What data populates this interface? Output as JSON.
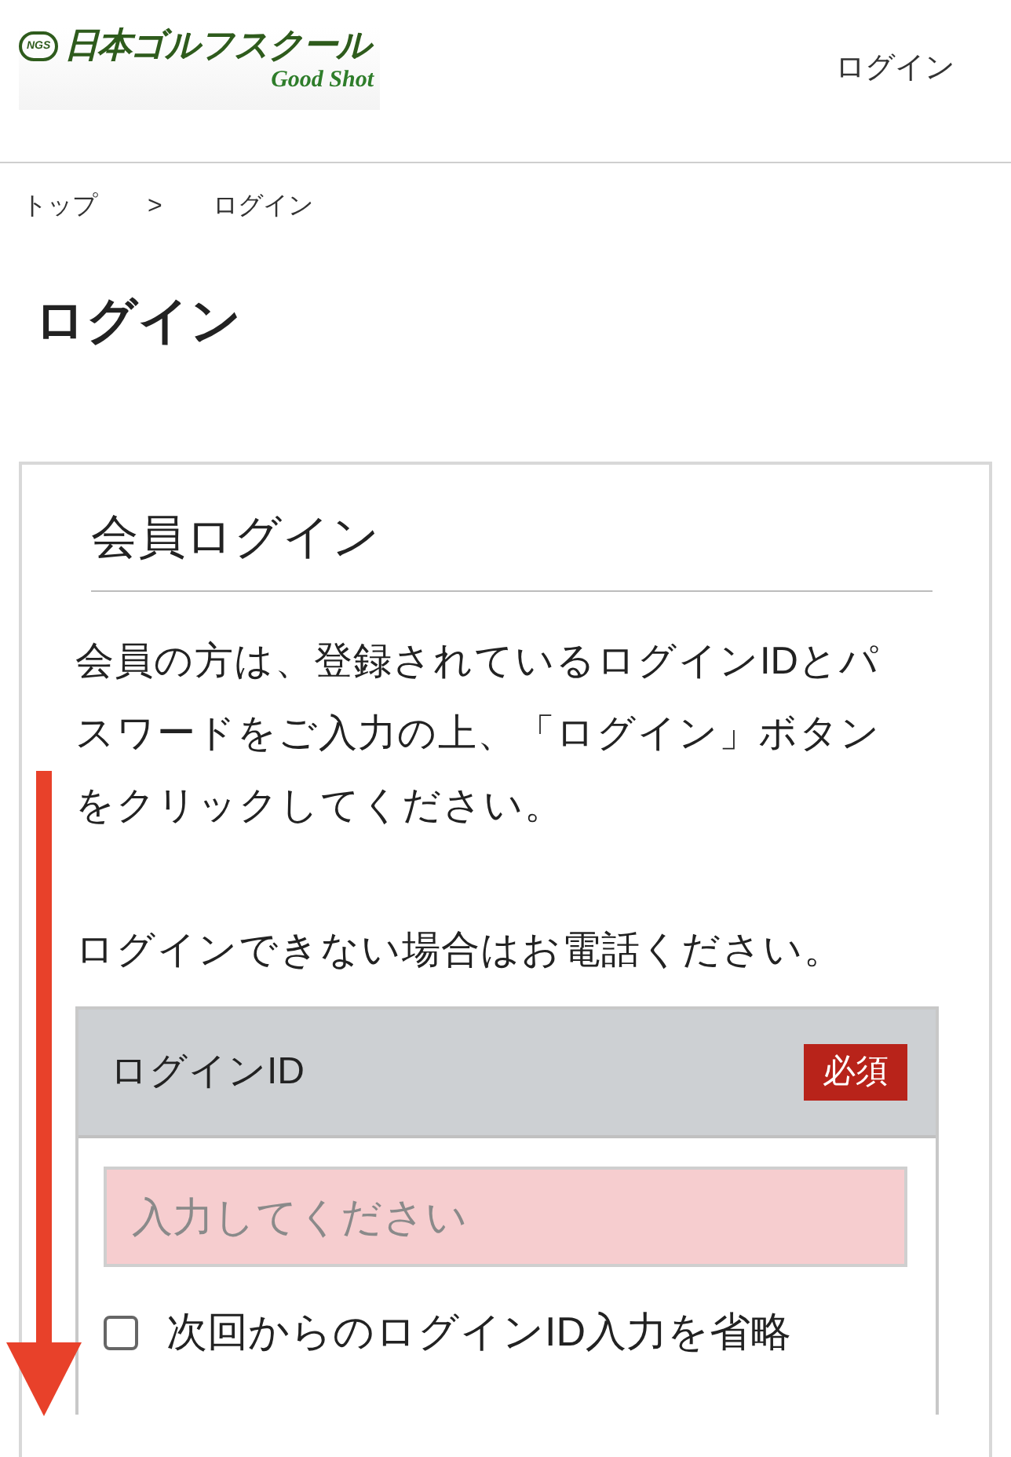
{
  "header": {
    "logo": {
      "mark": "NGS",
      "name": "日本ゴルフスクール",
      "tagline": "Good Shot"
    },
    "nav_link": "ログイン"
  },
  "breadcrumb": [
    {
      "label": "トップ"
    },
    {
      "label": ">"
    },
    {
      "label": "ログイン"
    }
  ],
  "page_title": "ログイン",
  "card": {
    "heading": "会員ログイン",
    "paragraphs": [
      "会員の方は、登録されているログインIDとパスワードをご入力の上、「ログイン」ボタンをクリックしてください。",
      "ログインできない場合はお電話ください。"
    ],
    "field": {
      "label": "ログインID",
      "badge": "必須",
      "placeholder": "入力してください"
    },
    "remember": {
      "label": "次回からのログインID入力を省略",
      "checked": false
    }
  },
  "scroll_hint": {
    "kind": "arrow"
  }
}
